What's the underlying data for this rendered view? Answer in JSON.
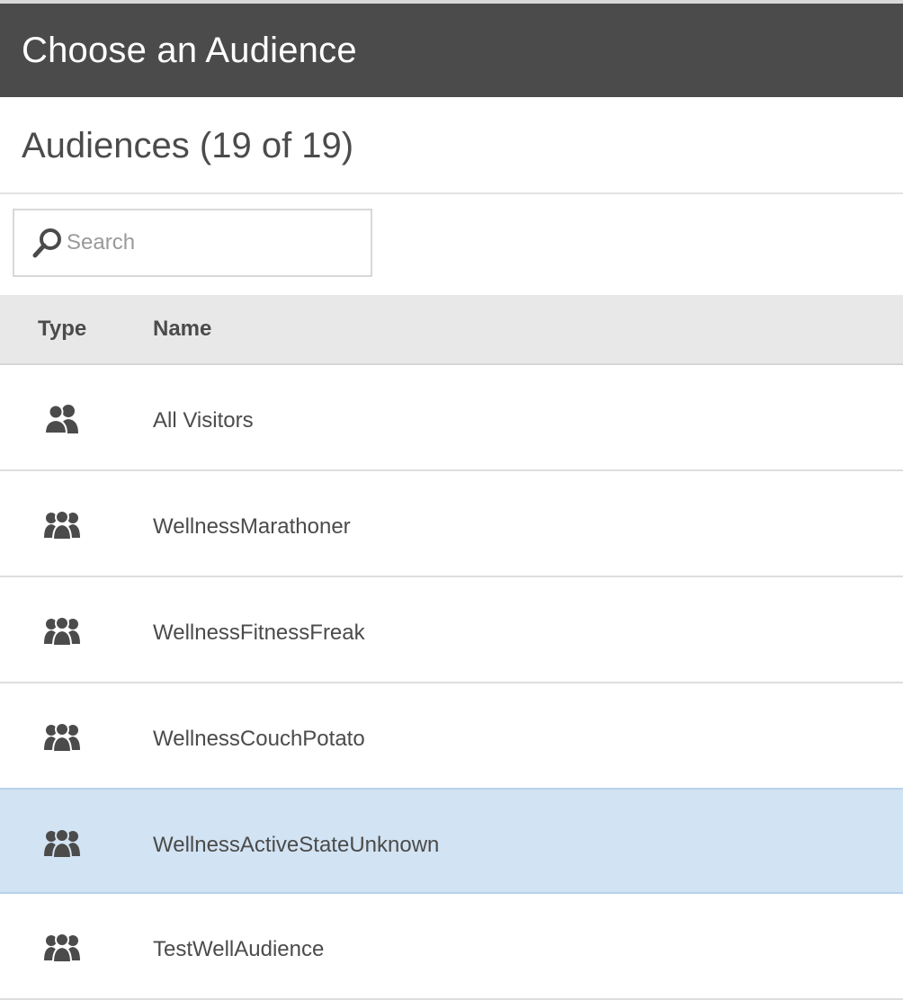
{
  "header": {
    "title": "Choose an Audience"
  },
  "subhead": {
    "title": "Audiences (19 of 19)"
  },
  "search": {
    "placeholder": "Search",
    "value": ""
  },
  "table": {
    "columns": {
      "type": "Type",
      "name": "Name"
    },
    "rows": [
      {
        "name": "All Visitors",
        "icon": "two-people-icon",
        "selected": false
      },
      {
        "name": "WellnessMarathoner",
        "icon": "group-icon",
        "selected": false
      },
      {
        "name": "WellnessFitnessFreak",
        "icon": "group-icon",
        "selected": false
      },
      {
        "name": "WellnessCouchPotato",
        "icon": "group-icon",
        "selected": false
      },
      {
        "name": "WellnessActiveStateUnknown",
        "icon": "group-icon",
        "selected": true
      },
      {
        "name": "TestWellAudience",
        "icon": "group-icon",
        "selected": false
      }
    ]
  },
  "colors": {
    "header_bg": "#4b4b4b",
    "selected_row_bg": "#d2e3f3",
    "table_head_bg": "#e8e8e8",
    "text": "#4b4b4b"
  }
}
